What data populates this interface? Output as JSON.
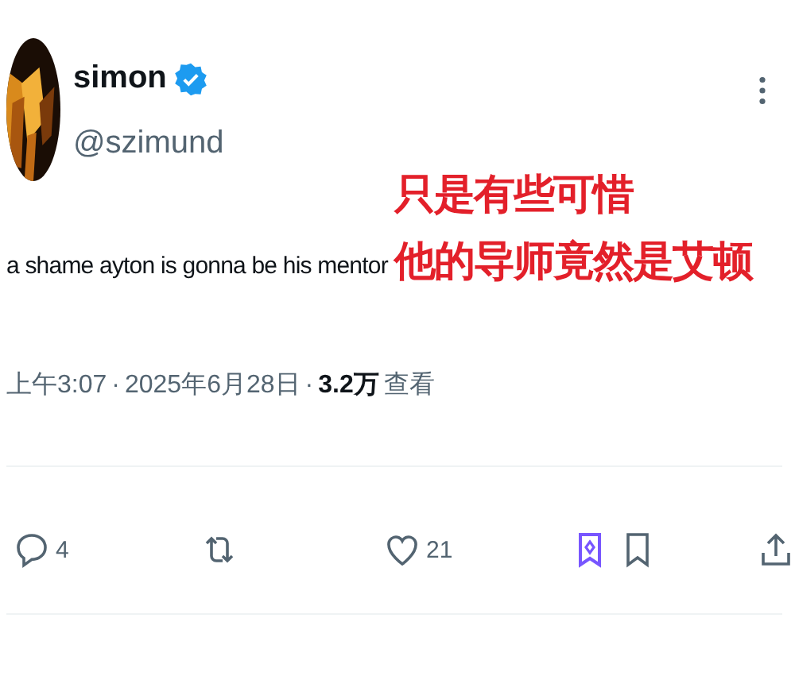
{
  "author": {
    "name": "simon",
    "verified": true,
    "handle": "@szimund"
  },
  "text": "a shame ayton is gonna be his mentor",
  "caption": [
    "只是有些可惜",
    "他的导师竟然是艾顿"
  ],
  "meta": {
    "time": "上午3:07",
    "sep1": "·",
    "date": "2025年6月28日",
    "sep2": "·",
    "views": "3.2万",
    "views_label": "查看"
  },
  "actions": [
    {
      "kind": "reply",
      "count": "4"
    },
    {
      "kind": "repost"
    },
    {
      "kind": "like",
      "count": "21"
    },
    {
      "kind": "grok"
    },
    {
      "kind": "bookmark"
    },
    {
      "kind": "share"
    }
  ]
}
